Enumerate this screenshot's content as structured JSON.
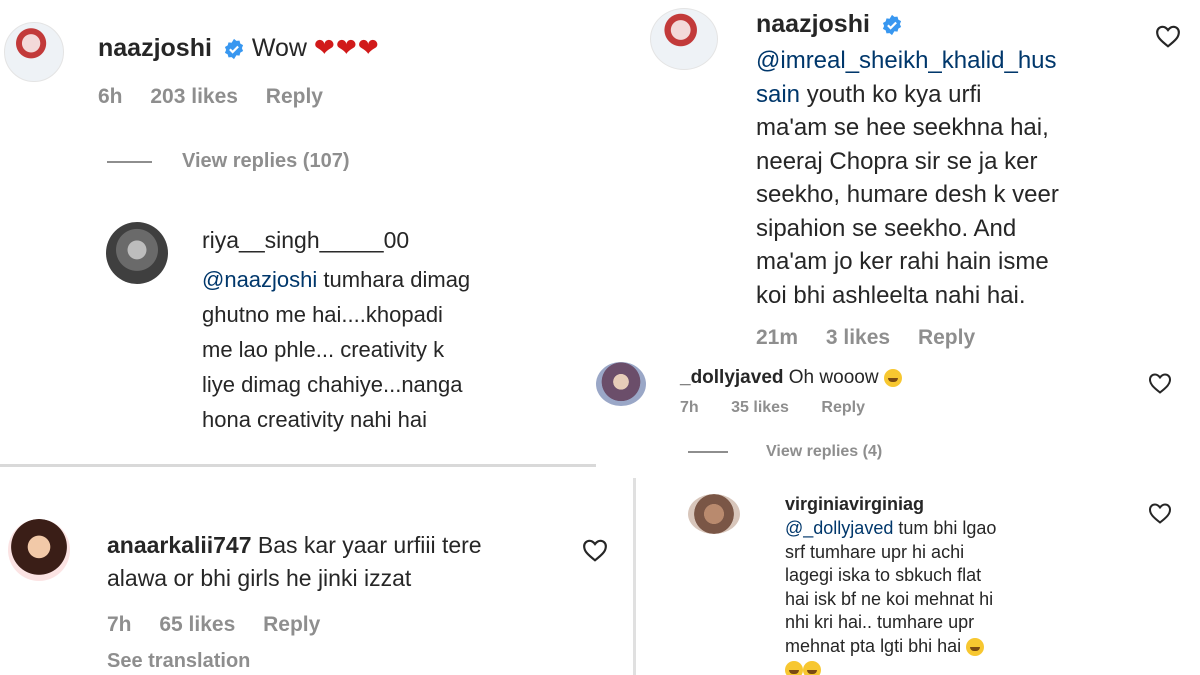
{
  "top_left": {
    "comment": {
      "username": "naazjoshi",
      "text": "Wow",
      "emoji": "❤❤❤",
      "time": "6h",
      "likes": "203 likes",
      "reply": "Reply"
    },
    "view_replies": "View replies (107)",
    "reply": {
      "username": "riya__singh_____00",
      "mention": "@naazjoshi",
      "text_lines": [
        "tumhara dimag",
        "ghutno me hai....khopadi",
        "me lao phle... creativity k",
        "liye dimag chahiye...nanga",
        "hona creativity nahi hai"
      ]
    }
  },
  "bottom_left": {
    "comment": {
      "username": "anaarkalii747",
      "text_line1": "Bas kar yaar urfiii tere",
      "text_line2": "alawa or bhi girls he jinki izzat",
      "time": "7h",
      "likes": "65 likes",
      "reply": "Reply",
      "see_translation": "See translation"
    }
  },
  "top_right": {
    "comment": {
      "username": "naazjoshi",
      "mention_line1": "@imreal_sheikh_khalid_hus",
      "mention_line2": "sain",
      "text_line2_rest": "youth ko kya urfi",
      "text_lines": [
        "ma'am se hee seekhna hai,",
        "neeraj Chopra sir se ja ker",
        "seekho, humare desh k veer",
        "sipahion se seekho. And",
        "ma'am jo ker rahi hain isme",
        "koi bhi ashleelta nahi hai."
      ],
      "time": "21m",
      "likes": "3 likes",
      "reply": "Reply"
    },
    "second_comment": {
      "username": "_dollyjaved",
      "text": "Oh wooow",
      "time": "7h",
      "likes": "35 likes",
      "reply": "Reply"
    },
    "view_replies": "View replies (4)"
  },
  "bottom_right": {
    "comment": {
      "username": "virginiavirginiag",
      "mention": "@_dollyjaved",
      "text_line1_rest": "tum bhi lgao",
      "text_lines": [
        "srf tumhare upr hi achi",
        "lagegi iska to sbkuch flat",
        "hai isk bf ne koi mehnat hi",
        "nhi kri hai.. tumhare upr",
        "mehnat pta lgti bhi hai"
      ]
    }
  },
  "icons": {
    "verified": "verified-badge-icon",
    "like": "heart-outline-icon",
    "emoji_laugh": "laughing-emoji-icon"
  },
  "colors": {
    "text": "#262626",
    "meta": "#8e8e8e",
    "mention": "#00376b",
    "verified": "#3897f0",
    "hearts": "#d11a1a"
  }
}
